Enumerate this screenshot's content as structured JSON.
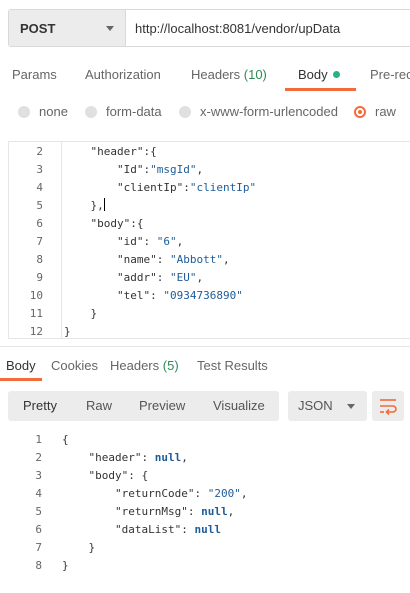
{
  "request": {
    "method": "POST",
    "url": "http://localhost:8081/vendor/upData"
  },
  "request_tabs": {
    "params": "Params",
    "authorization": "Authorization",
    "headers_label": "Headers",
    "headers_count": "(10)",
    "body": "Body",
    "prerequest": "Pre-rec"
  },
  "body_types": {
    "none": "none",
    "form_data": "form-data",
    "urlencoded": "x-www-form-urlencoded",
    "raw": "raw",
    "selected": "raw"
  },
  "request_body": {
    "line_numbers": [
      "2",
      "3",
      "4",
      "5",
      "6",
      "7",
      "8",
      "9",
      "10",
      "11",
      "12"
    ],
    "lines": [
      "    \"header\":{",
      "        \"Id\":\"msgId\",",
      "        \"clientIp\":\"clientIp\"",
      "    },",
      "    \"body\":{",
      "        \"id\": \"6\",",
      "        \"name\": \"Abbott\",",
      "        \"addr\": \"EU\",",
      "        \"tel\": \"0934736890\"",
      "    }",
      "}"
    ]
  },
  "response_tabs": {
    "body": "Body",
    "cookies": "Cookies",
    "headers_label": "Headers",
    "headers_count": "(5)",
    "test_results": "Test Results"
  },
  "response_toolbar": {
    "pretty": "Pretty",
    "raw": "Raw",
    "preview": "Preview",
    "visualize": "Visualize",
    "format": "JSON"
  },
  "response_body": {
    "line_numbers": [
      "1",
      "2",
      "3",
      "4",
      "5",
      "6",
      "7",
      "8"
    ],
    "lines": [
      "{",
      "    \"header\": null,",
      "    \"body\": {",
      "        \"returnCode\": \"200\",",
      "        \"returnMsg\": null,",
      "        \"dataList\": null",
      "    }",
      "}"
    ]
  },
  "colors": {
    "accent": "#f26b3a",
    "active_dot": "#26b47f",
    "count": "#2e8b57",
    "json_value": "#1e5c99"
  }
}
